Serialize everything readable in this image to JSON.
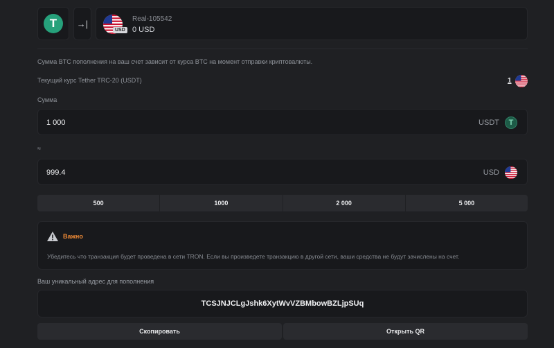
{
  "header": {
    "coin_icon": "tether-icon",
    "login_icon": "login-arrow-icon",
    "account_name": "Real-105542",
    "account_balance": "0 USD",
    "currency_tag": "USD"
  },
  "info_text": "Сумма BTC пополнения на ваш счет зависит от курса BTC на момент отправки криптовалюты.",
  "rate": {
    "label": "Текущий курс Tether TRC-20 (USDT)",
    "value": "1"
  },
  "amount": {
    "label": "Сумма",
    "value": "1 000",
    "currency": "USDT"
  },
  "approx_sign": "≈",
  "converted": {
    "value": "999.4",
    "currency": "USD"
  },
  "presets": [
    "500",
    "1000",
    "2 000",
    "5 000"
  ],
  "warning": {
    "title": "Важно",
    "text": "Убедитесь что транзакция будет проведена в сети TRON. Если вы произведете транзакцию в другой сети, ваши средства не будут зачислены на счет."
  },
  "address": {
    "label": "Ваш уникальный адрес для пополнения",
    "value": "TCSJNJCLgJshk6XytWvVZBMbowBZLjpSUq"
  },
  "buttons": {
    "copy": "Скопировать",
    "qr": "Открыть QR"
  },
  "colors": {
    "background": "#1f2023",
    "panel": "#18191c",
    "tether": "#26a17b",
    "warning": "#f08b36"
  }
}
